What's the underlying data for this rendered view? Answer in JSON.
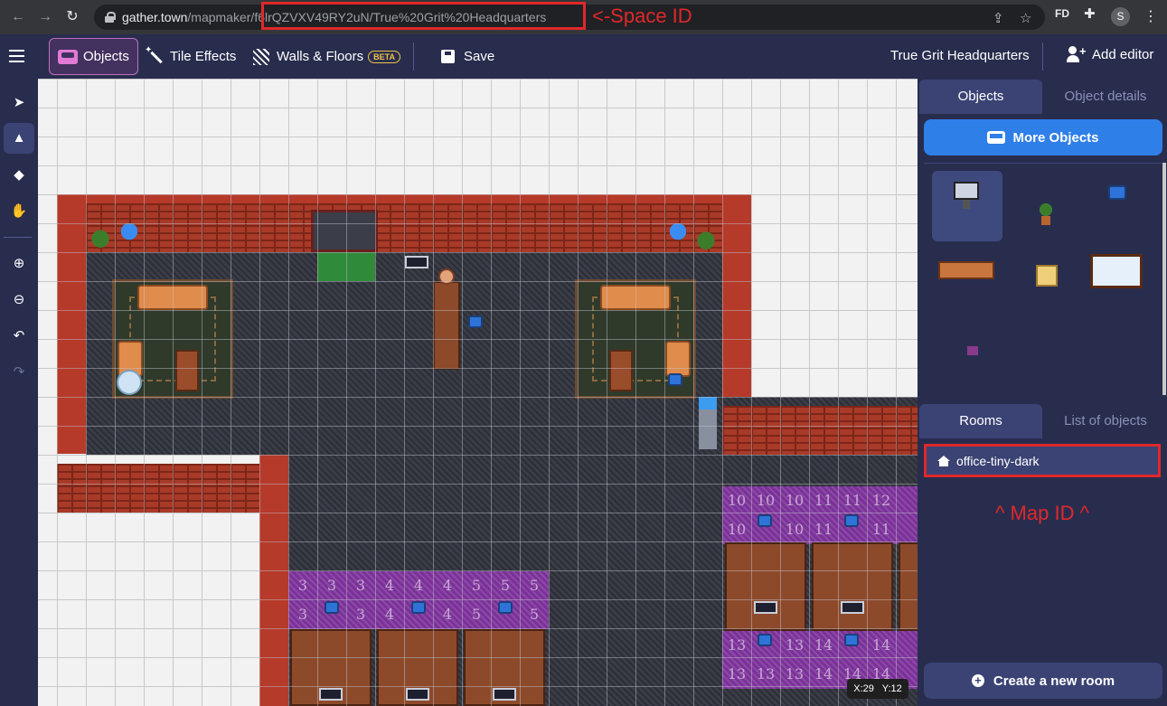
{
  "browser": {
    "url_host": "gather.town",
    "url_path": "/mapmaker/",
    "url_space_id": "f6lrQZVXV49RY2uN/True%20Grit%20Headquarters",
    "profile_initial": "S",
    "extension_label": "FD"
  },
  "annotations": {
    "space_id_note": "<-Space ID",
    "map_id_note": "^ Map ID ^"
  },
  "toolbar": {
    "objects_label": "Objects",
    "tile_effects_label": "Tile Effects",
    "walls_floors_label": "Walls & Floors",
    "beta_badge": "BETA",
    "save_label": "Save",
    "space_name": "True Grit Headquarters",
    "add_editor_label": "Add editor"
  },
  "left_tools": [
    {
      "icon": "select-arrow-icon",
      "active": false
    },
    {
      "icon": "stamp-icon",
      "active": true
    },
    {
      "icon": "eraser-icon",
      "active": false
    },
    {
      "icon": "hand-icon",
      "active": false
    },
    {
      "icon": "zoom-in-icon",
      "active": false
    },
    {
      "icon": "zoom-out-icon",
      "active": false
    },
    {
      "icon": "undo-icon",
      "active": false
    },
    {
      "icon": "redo-icon",
      "active": false
    }
  ],
  "canvas": {
    "coords_x": "X:29",
    "coords_y": "Y:12",
    "desk_numbers": {
      "group_left_top": [
        "3",
        "3",
        "3",
        "4",
        "4",
        "4",
        "5",
        "5",
        "5"
      ],
      "group_left_bottom": [
        "3",
        "3",
        "4",
        "4",
        "5",
        "5"
      ],
      "group_right_top": [
        "10",
        "10",
        "10",
        "11",
        "11",
        "12"
      ],
      "group_right_row2": [
        "10",
        "10",
        "11",
        "11"
      ],
      "group_right_bottom": [
        "13",
        "13",
        "13",
        "14",
        "14",
        "14"
      ],
      "group_right_bottom2": [
        "13",
        "13",
        "13",
        "14",
        "14",
        "14"
      ]
    }
  },
  "right_panel": {
    "tab_objects": "Objects",
    "tab_object_details": "Object details",
    "more_objects_label": "More Objects",
    "object_icons": [
      "computer-desk-icon",
      "potted-plant-icon",
      "blue-chair-icon",
      "wooden-table-icon",
      "sticky-note-board-icon",
      "whiteboard-icon",
      "small-pink-object-icon"
    ],
    "tab_rooms": "Rooms",
    "tab_list_objects": "List of objects",
    "room_name": "office-tiny-dark",
    "create_room_label": "Create a new room"
  },
  "colors": {
    "toolbar_bg": "#282d4e",
    "accent_blue": "#2f7fe8",
    "annotation_red": "#e0282a",
    "beta_yellow": "#f1c24a"
  }
}
